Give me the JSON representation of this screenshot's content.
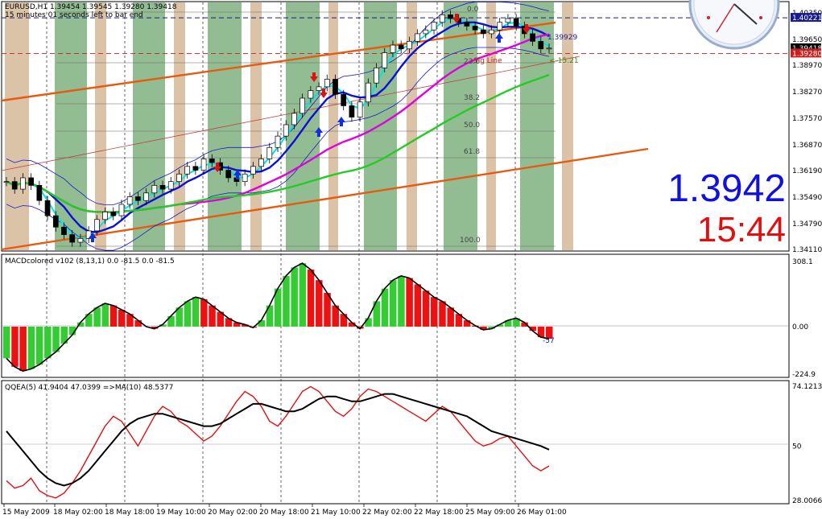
{
  "header": {
    "symbol_line": "EURUSD,H1  1.39454 1.39545 1.39280 1.39418",
    "timer_line": "15 minutes 01 seconds left to bar end"
  },
  "overlay": {
    "price": "1.3942",
    "time": "15:44",
    "price_color": "#1010e0",
    "time_color": "#e01010",
    "pivot_value": "1.39929",
    "spread_text": "<-15.21",
    "sig_line_label": "Sig Line"
  },
  "fib_labels": [
    "0.0",
    "23.6",
    "38.2",
    "50.0",
    "61.8",
    "100.0"
  ],
  "macd": {
    "title": "MACDcolored v102 (8,13,1) 0.0 -81.5 0.0 -81.5",
    "last_value": "-57"
  },
  "qqea": {
    "title": "QQEA(5) 41.9404 47.0399  =>MA(10) 48.5377"
  },
  "chart_data": [
    {
      "type": "candlestick",
      "panel": "price",
      "title": "EURUSD,H1",
      "open": 1.39454,
      "high": 1.39545,
      "low": 1.3928,
      "close": 1.39418,
      "ylim": [
        1.3411,
        1.4035
      ],
      "y_ticks": [
        "1.40350",
        "1.40221",
        "1.39650",
        "1.39418",
        "1.39280",
        "1.38970",
        "1.38270",
        "1.37570",
        "1.36870",
        "1.36190",
        "1.35490",
        "1.34790",
        "1.34110"
      ],
      "highlighted_prices": [
        {
          "value": "1.40221",
          "color": "#1a1a8c"
        },
        {
          "value": "1.39418",
          "color": "#000000"
        },
        {
          "value": "1.39280",
          "color": "#c81e1e"
        }
      ],
      "close_series": [
        1.359,
        1.357,
        1.36,
        1.358,
        1.354,
        1.35,
        1.347,
        1.345,
        1.343,
        1.344,
        1.346,
        1.349,
        1.351,
        1.35,
        1.353,
        1.355,
        1.354,
        1.356,
        1.358,
        1.357,
        1.359,
        1.361,
        1.363,
        1.362,
        1.365,
        1.364,
        1.362,
        1.36,
        1.359,
        1.361,
        1.363,
        1.365,
        1.368,
        1.371,
        1.374,
        1.377,
        1.381,
        1.383,
        1.384,
        1.386,
        1.382,
        1.379,
        1.376,
        1.38,
        1.385,
        1.389,
        1.393,
        1.395,
        1.394,
        1.396,
        1.398,
        1.399,
        1.401,
        1.403,
        1.402,
        1.401,
        1.4,
        1.399,
        1.398,
        1.399,
        1.401,
        1.402,
        1.4,
        1.398,
        1.396,
        1.394,
        1.3942
      ],
      "series_colors": {
        "sma_fast": "#00e5e5",
        "sma_mid": "#0a10d8",
        "ma_magenta": "#e000e0",
        "ma_green": "#22cc22",
        "channel": "#e85a10"
      }
    },
    {
      "type": "bar",
      "panel": "macd",
      "title": "MACDcolored v102 (8,13,1)",
      "ylim": [
        -224.9,
        308.1
      ],
      "y_ticks": [
        "308.1",
        "0.00",
        "-224.9"
      ],
      "values": [
        -150,
        -190,
        -210,
        -200,
        -180,
        -150,
        -120,
        -80,
        -40,
        20,
        60,
        90,
        110,
        100,
        80,
        60,
        30,
        0,
        -10,
        10,
        50,
        90,
        120,
        140,
        130,
        100,
        70,
        40,
        20,
        10,
        -5,
        30,
        100,
        180,
        240,
        280,
        300,
        270,
        220,
        160,
        100,
        60,
        20,
        -10,
        40,
        120,
        180,
        220,
        240,
        230,
        200,
        170,
        140,
        120,
        90,
        60,
        30,
        5,
        -15,
        -10,
        10,
        30,
        40,
        20,
        -20,
        -50,
        -57
      ],
      "last_value": -57
    },
    {
      "type": "line",
      "panel": "qqea",
      "title": "QQEA(5)",
      "ylim": [
        28.0066,
        74.1213
      ],
      "y_ticks": [
        "74.1213",
        "50",
        "28.0066"
      ],
      "series": [
        {
          "name": "QQEA(5)",
          "color": "#e01010",
          "values": [
            36,
            33,
            34,
            37,
            32,
            30,
            29,
            31,
            35,
            40,
            46,
            52,
            58,
            62,
            60,
            55,
            50,
            56,
            62,
            66,
            64,
            60,
            58,
            55,
            52,
            54,
            58,
            63,
            68,
            72,
            70,
            66,
            60,
            58,
            62,
            67,
            72,
            74,
            72,
            68,
            64,
            62,
            65,
            70,
            73,
            72,
            70,
            68,
            66,
            64,
            62,
            60,
            63,
            66,
            64,
            60,
            56,
            52,
            50,
            51,
            53,
            54,
            50,
            46,
            42,
            40,
            41.94
          ]
        },
        {
          "name": "MA(10)",
          "color": "#000000",
          "values": [
            56,
            52,
            48,
            44,
            40,
            37,
            35,
            34,
            35,
            37,
            40,
            44,
            48,
            52,
            56,
            59,
            61,
            62,
            63,
            63,
            62,
            61,
            60,
            59,
            58,
            58,
            59,
            61,
            63,
            65,
            67,
            67,
            66,
            65,
            64,
            64,
            65,
            67,
            69,
            70,
            70,
            69,
            68,
            68,
            69,
            70,
            71,
            71,
            70,
            69,
            68,
            67,
            66,
            65,
            64,
            63,
            62,
            60,
            58,
            56,
            55,
            54,
            53,
            52,
            51,
            50,
            48.54
          ]
        }
      ]
    }
  ],
  "x_axis": {
    "ticks": [
      "15 May 2009",
      "18 May 02:00",
      "18 May 18:00",
      "19 May 10:00",
      "20 May 02:00",
      "20 May 18:00",
      "21 May 10:00",
      "22 May 02:00",
      "22 May 18:00",
      "25 May 09:00",
      "26 May 01:00"
    ]
  }
}
